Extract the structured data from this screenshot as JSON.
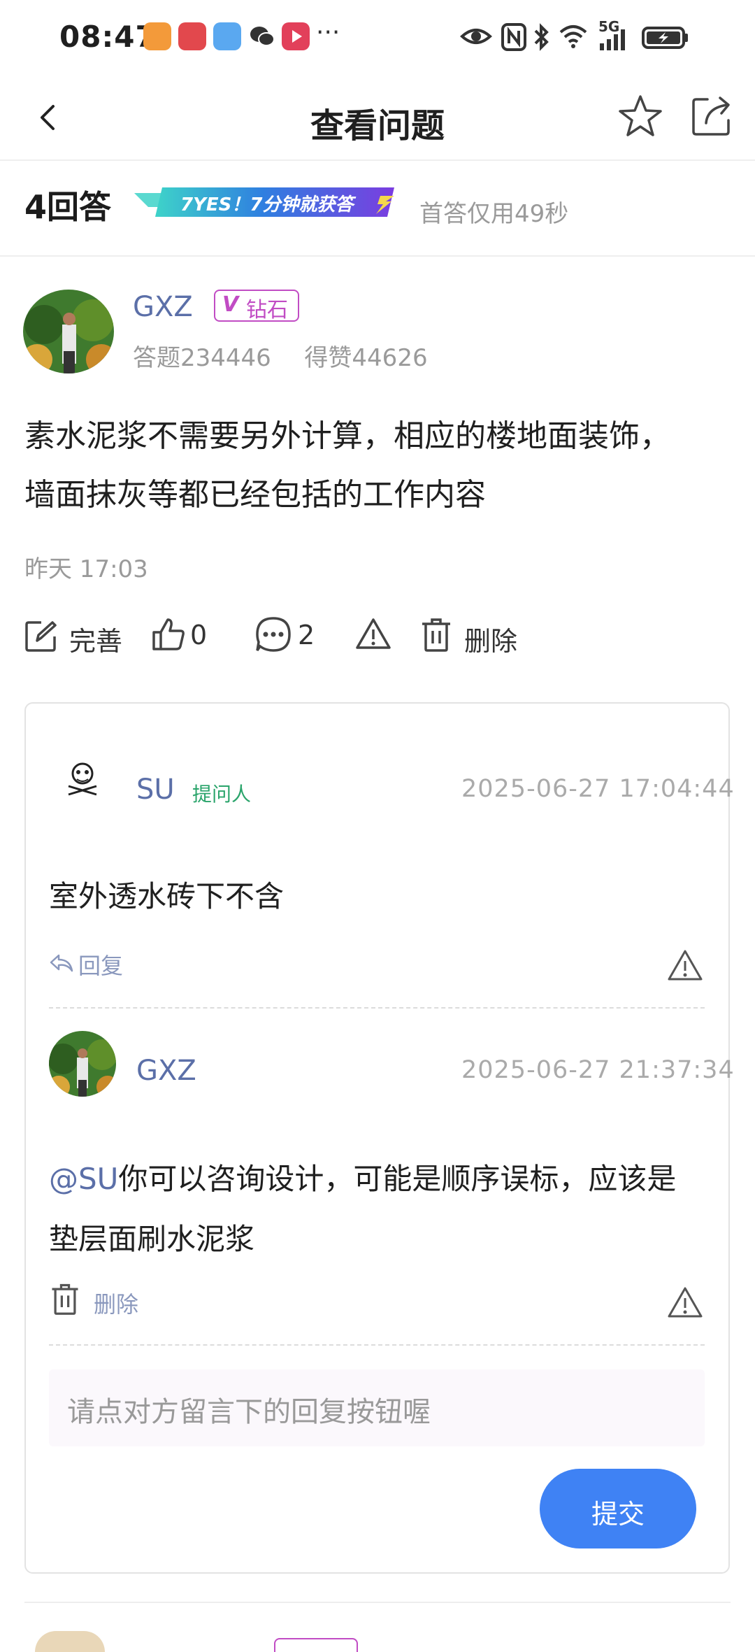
{
  "status_bar": {
    "time": "08:47",
    "more": "···",
    "network": "5G"
  },
  "nav": {
    "title": "查看问题"
  },
  "answers_header": {
    "count_label": "4回答",
    "badge_text": "7YES！7分钟就获答",
    "first_answer": "首答仅用49秒"
  },
  "answer": {
    "user": "GXZ",
    "level_badge": "钻石",
    "questions": "答题234446",
    "likes_received": "得赞44626",
    "text_line1": "素水泥浆不需要另外计算，相应的楼地面装饰，",
    "text_line2": "墙面抹灰等都已经包括的工作内容",
    "time": "昨天 17:03",
    "actions": {
      "improve": "完善",
      "like_count": "0",
      "comment_count": "2",
      "delete": "删除"
    }
  },
  "comments": [
    {
      "user": "SU",
      "role": "提问人",
      "time": "2025-06-27 17:04:44",
      "text": "室外透水砖下不含",
      "reply": "回复"
    },
    {
      "user": "GXZ",
      "time": "2025-06-27 21:37:34",
      "mention": "@SU",
      "text_rest": "你可以咨询设计，可能是顺序误标，应该是",
      "text_line2": "垫层面刷水泥浆",
      "delete": "删除"
    }
  ],
  "comment_input": {
    "placeholder": "请点对方留言下的回复按钮喔"
  },
  "submit_label": "提交",
  "colors": {
    "accent": "#3f82f4",
    "username": "#5b6fa8",
    "diamond": "#c14cc4",
    "asker": "#2aa46b"
  }
}
